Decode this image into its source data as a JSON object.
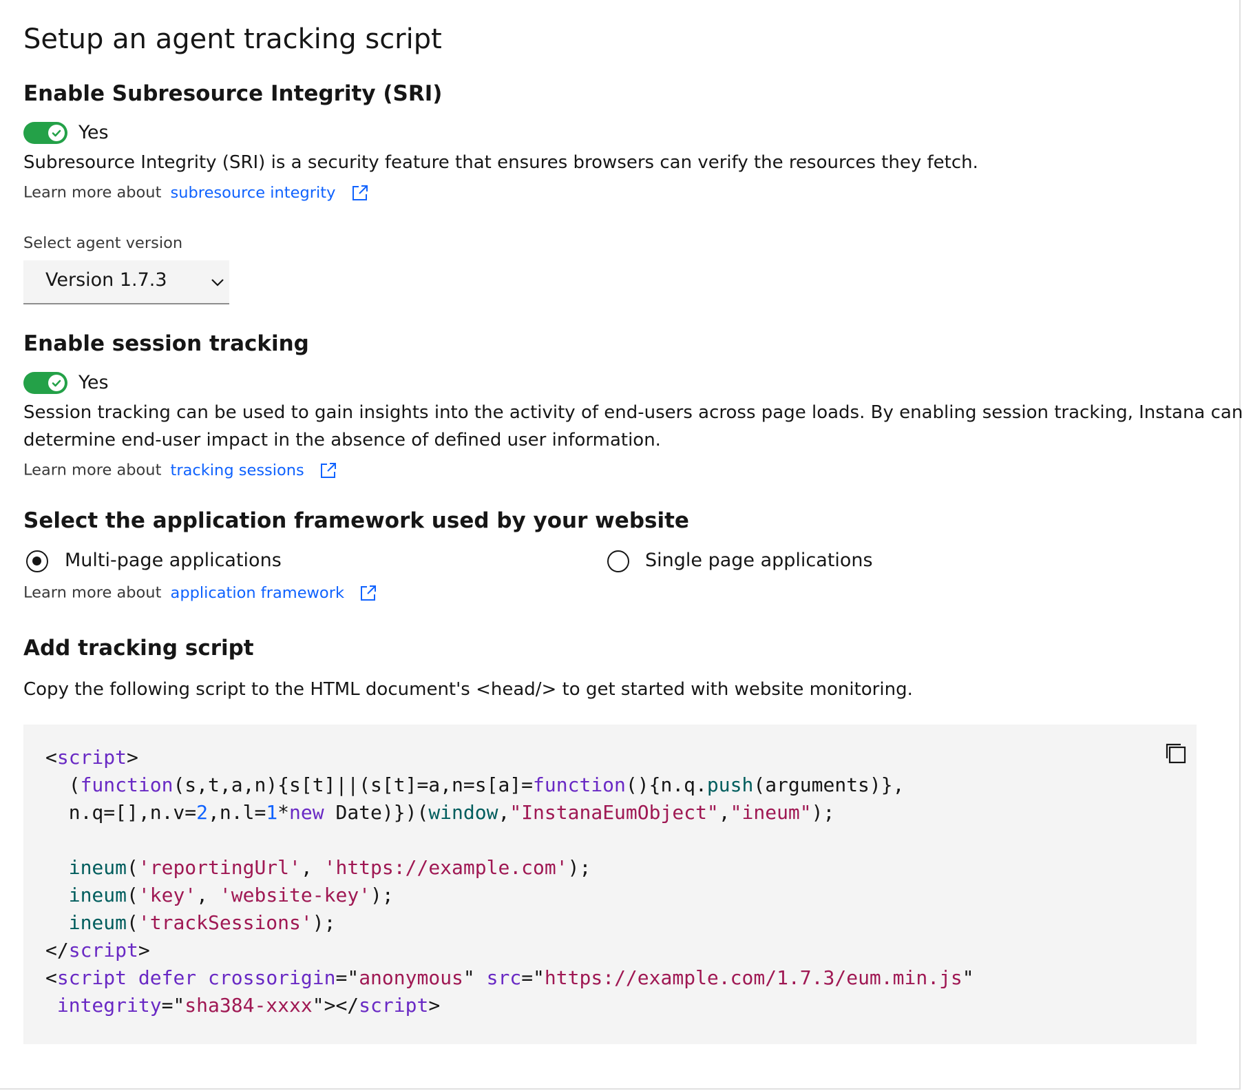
{
  "page": {
    "title": "Setup an agent tracking script"
  },
  "sri": {
    "heading": "Enable Subresource Integrity (SRI)",
    "toggle_label": "Yes",
    "toggle_on": true,
    "description": "Subresource Integrity (SRI) is a security feature that ensures browsers can verify the resources they fetch.",
    "learn_prefix": "Learn more about",
    "learn_link": "subresource integrity"
  },
  "agent_version": {
    "label": "Select agent version",
    "selected": "Version 1.7.3"
  },
  "session": {
    "heading": "Enable session tracking",
    "toggle_label": "Yes",
    "toggle_on": true,
    "description_line1": "Session tracking can be used to gain insights into the activity of end-users across page loads. By enabling session tracking, Instana can",
    "description_line2": "determine end-user impact in the absence of defined user information.",
    "learn_prefix": "Learn more about",
    "learn_link": "tracking sessions"
  },
  "framework": {
    "heading": "Select the application framework used by your website",
    "options": [
      {
        "label": "Multi-page applications",
        "selected": true
      },
      {
        "label": "Single page applications",
        "selected": false
      }
    ],
    "learn_prefix": "Learn more about",
    "learn_link": "application framework"
  },
  "tracking_script": {
    "heading": "Add tracking script",
    "description": "Copy the following script to the HTML document's <head/> to get started with website monitoring.",
    "code_lines": [
      [
        {
          "t": "<",
          "c": ""
        },
        {
          "t": "script",
          "c": "kw"
        },
        {
          "t": ">",
          "c": ""
        }
      ],
      [
        {
          "t": "  (",
          "c": ""
        },
        {
          "t": "function",
          "c": "kw"
        },
        {
          "t": "(s,t,a,n){s[t]||(s[t]=a,n=s[a]=",
          "c": ""
        },
        {
          "t": "function",
          "c": "kw"
        },
        {
          "t": "(){n.q.",
          "c": ""
        },
        {
          "t": "push",
          "c": "fn"
        },
        {
          "t": "(arguments)},",
          "c": ""
        }
      ],
      [
        {
          "t": "  n.q=[],n.v=",
          "c": ""
        },
        {
          "t": "2",
          "c": "num"
        },
        {
          "t": ",n.l=",
          "c": ""
        },
        {
          "t": "1",
          "c": "num"
        },
        {
          "t": "*",
          "c": ""
        },
        {
          "t": "new",
          "c": "kw"
        },
        {
          "t": " Date)})(",
          "c": ""
        },
        {
          "t": "window",
          "c": "fn"
        },
        {
          "t": ",",
          "c": ""
        },
        {
          "t": "\"InstanaEumObject\"",
          "c": "str"
        },
        {
          "t": ",",
          "c": ""
        },
        {
          "t": "\"ineum\"",
          "c": "str"
        },
        {
          "t": ");",
          "c": ""
        }
      ],
      [],
      [
        {
          "t": "  ",
          "c": ""
        },
        {
          "t": "ineum",
          "c": "fn"
        },
        {
          "t": "(",
          "c": ""
        },
        {
          "t": "'reportingUrl'",
          "c": "str"
        },
        {
          "t": ", ",
          "c": ""
        },
        {
          "t": "'https://example.com'",
          "c": "str"
        },
        {
          "t": ");",
          "c": ""
        }
      ],
      [
        {
          "t": "  ",
          "c": ""
        },
        {
          "t": "ineum",
          "c": "fn"
        },
        {
          "t": "(",
          "c": ""
        },
        {
          "t": "'key'",
          "c": "str"
        },
        {
          "t": ", ",
          "c": ""
        },
        {
          "t": "'website-key'",
          "c": "str"
        },
        {
          "t": ");",
          "c": ""
        }
      ],
      [
        {
          "t": "  ",
          "c": ""
        },
        {
          "t": "ineum",
          "c": "fn"
        },
        {
          "t": "(",
          "c": ""
        },
        {
          "t": "'trackSessions'",
          "c": "str"
        },
        {
          "t": ");",
          "c": ""
        }
      ],
      [
        {
          "t": "</",
          "c": ""
        },
        {
          "t": "script",
          "c": "kw"
        },
        {
          "t": ">",
          "c": ""
        }
      ],
      [
        {
          "t": "<",
          "c": ""
        },
        {
          "t": "script",
          "c": "kw"
        },
        {
          "t": " ",
          "c": ""
        },
        {
          "t": "defer",
          "c": "attr"
        },
        {
          "t": " ",
          "c": ""
        },
        {
          "t": "crossorigin",
          "c": "attr"
        },
        {
          "t": "=\"",
          "c": ""
        },
        {
          "t": "anonymous",
          "c": "str"
        },
        {
          "t": "\" ",
          "c": ""
        },
        {
          "t": "src",
          "c": "attr"
        },
        {
          "t": "=\"",
          "c": ""
        },
        {
          "t": "https://example.com/1.7.3/eum.min.js",
          "c": "str"
        },
        {
          "t": "\"",
          "c": ""
        }
      ],
      [
        {
          "t": " ",
          "c": ""
        },
        {
          "t": "integrity",
          "c": "attr"
        },
        {
          "t": "=\"",
          "c": ""
        },
        {
          "t": "sha384-xxxx",
          "c": "str"
        },
        {
          "t": "\"></",
          "c": ""
        },
        {
          "t": "script",
          "c": "kw"
        },
        {
          "t": ">",
          "c": ""
        }
      ]
    ]
  },
  "icons": {
    "toggle_check": "checkmark-icon",
    "external_link": "launch-icon",
    "dropdown": "chevron-down-icon",
    "copy": "copy-icon"
  },
  "colors": {
    "toggle_on": "#24a148",
    "link": "#0f62fe",
    "code_background": "#f4f4f4"
  }
}
